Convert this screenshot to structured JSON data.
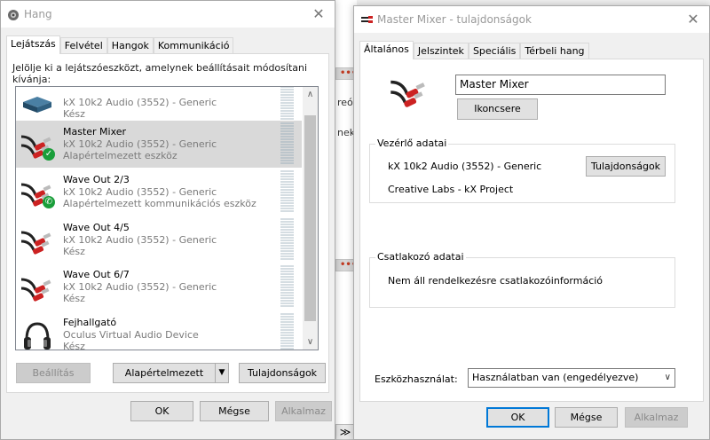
{
  "background": {
    "fragment1": "reó",
    "fragment2": "nek",
    "mark": "•••",
    "chevron": "≫"
  },
  "hang_dialog": {
    "title": "Hang",
    "tabs": [
      "Lejátszás",
      "Felvétel",
      "Hangok",
      "Kommunikáció"
    ],
    "instruction": "Jelölje ki a lejátszóeszközt, amelynek beállításait módosítani kívánja:",
    "devices": [
      {
        "name": "",
        "desc": "kX 10k2 Audio (3552) - Generic",
        "status": "Kész"
      },
      {
        "name": "Master Mixer",
        "desc": "kX 10k2 Audio (3552) - Generic",
        "status": "Alapértelmezett eszköz"
      },
      {
        "name": "Wave Out 2/3",
        "desc": "kX 10k2 Audio (3552) - Generic",
        "status": "Alapértelmezett kommunikációs eszköz"
      },
      {
        "name": "Wave Out 4/5",
        "desc": "kX 10k2 Audio (3552) - Generic",
        "status": "Kész"
      },
      {
        "name": "Wave Out 6/7",
        "desc": "kX 10k2 Audio (3552) - Generic",
        "status": "Kész"
      },
      {
        "name": "Fejhallgató",
        "desc": "Oculus Virtual Audio Device",
        "status": "Kész"
      }
    ],
    "buttons": {
      "settings": "Beállítás",
      "default": "Alapértelmezett",
      "properties": "Tulajdonságok",
      "ok": "OK",
      "cancel": "Mégse",
      "apply": "Alkalmaz"
    }
  },
  "mixer_dialog": {
    "title": "Master Mixer - tulajdonságok",
    "tabs": [
      "Általános",
      "Jelszintek",
      "Speciális",
      "Térbeli hang"
    ],
    "device_name": "Master Mixer",
    "change_icon": "Ikoncsere",
    "controller": {
      "legend": "Vezérlő adatai",
      "line1": "kX 10k2 Audio (3552) - Generic",
      "line2": "Creative Labs - kX Project",
      "properties": "Tulajdonságok"
    },
    "jack": {
      "legend": "Csatlakozó adatai",
      "text": "Nem áll rendelkezésre csatlakozóinformáció"
    },
    "usage": {
      "label": "Eszközhasználat:",
      "value": "Használatban van (engedélyezve)"
    },
    "buttons": {
      "ok": "OK",
      "cancel": "Mégse",
      "apply": "Alkalmaz"
    }
  },
  "colors": {
    "accent": "#0078d7",
    "success_badge": "#1a9e3a",
    "selected_row": "#d9d9d9"
  }
}
